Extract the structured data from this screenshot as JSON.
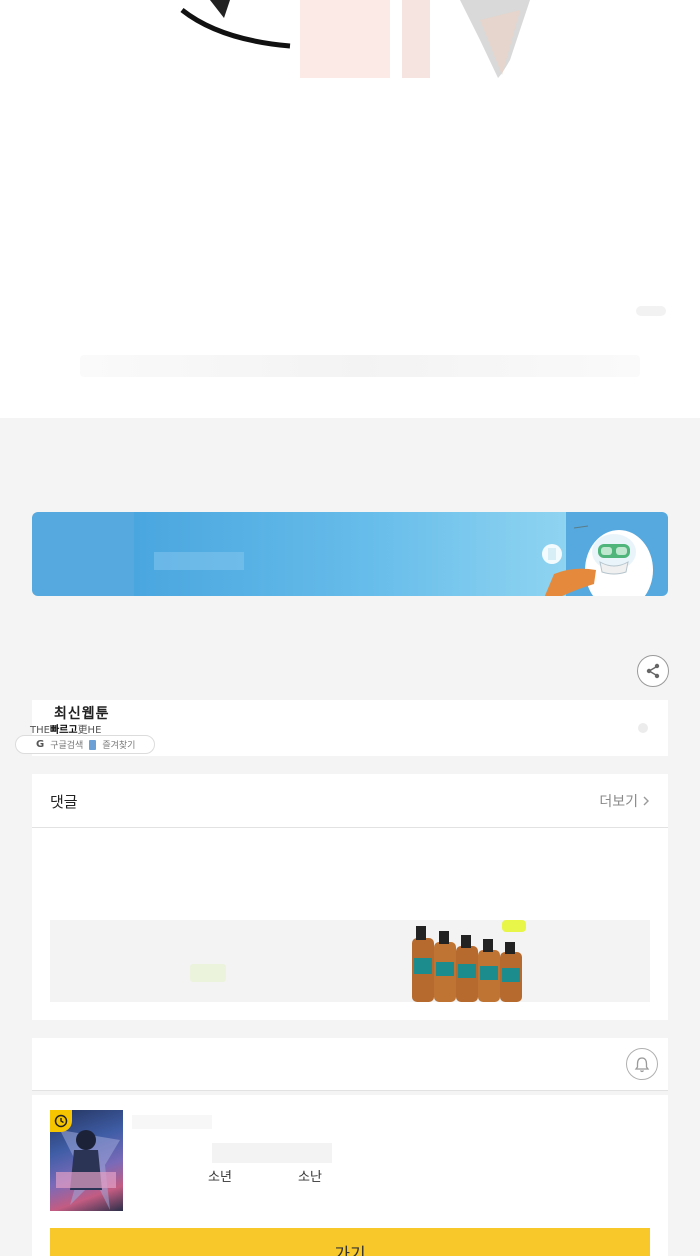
{
  "latest_webtoon": {
    "title": "최신웹툰",
    "subtitle_prefix": "THE",
    "subtitle_bold": "빠르고",
    "subtitle_suffix": "更HE",
    "search_label": "구글검색",
    "bookmark_label": "즐겨찾기"
  },
  "comments": {
    "title": "댓글",
    "more_label": "더보기",
    "more_icon": "chevron-right-icon"
  },
  "recommended": {
    "tags": [
      "소년",
      "소난"
    ],
    "go_label": "가기"
  },
  "colors": {
    "accent_yellow": "#f8c82a",
    "banner_blue": "#56a9de",
    "page_bg": "#f4f4f4"
  },
  "icons": {
    "share": "share-icon",
    "bell": "bell-icon",
    "clock": "clock-icon"
  }
}
